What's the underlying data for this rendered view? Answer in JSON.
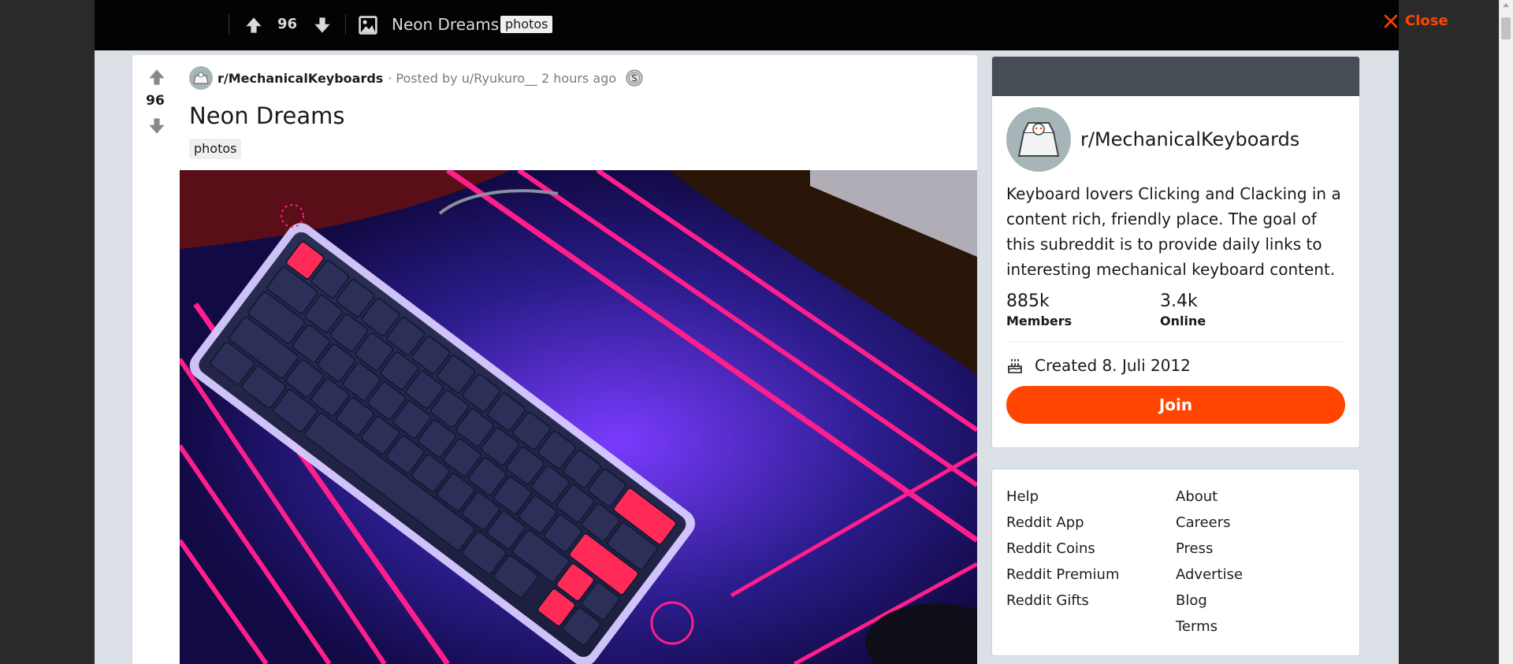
{
  "topbar": {
    "score": "96",
    "title": "Neon Dreams",
    "flair": "photos",
    "close_label": "Close"
  },
  "post": {
    "score": "96",
    "subreddit": "r/MechanicalKeyboards",
    "separator": "·",
    "posted_by": "Posted by u/Ryukuro__",
    "time": "2 hours ago",
    "title": "Neon Dreams",
    "flair": "photos"
  },
  "sidebar": {
    "community_name": "r/MechanicalKeyboards",
    "description": "Keyboard lovers Clicking and Clacking in a content rich, friendly place. The goal of this subreddit is to provide daily links to interesting mechanical keyboard content.",
    "members_count": "885k",
    "members_label": "Members",
    "online_count": "3.4k",
    "online_label": "Online",
    "created": "Created 8. Juli 2012",
    "join_label": "Join"
  },
  "footer_links": {
    "col1": [
      "Help",
      "Reddit App",
      "Reddit Coins",
      "Reddit Premium",
      "Reddit Gifts"
    ],
    "col2": [
      "About",
      "Careers",
      "Press",
      "Advertise",
      "Blog",
      "Terms"
    ]
  },
  "colors": {
    "accent": "#ff4500",
    "topbar_bg": "#030303",
    "page_bg": "#dae0e6"
  }
}
